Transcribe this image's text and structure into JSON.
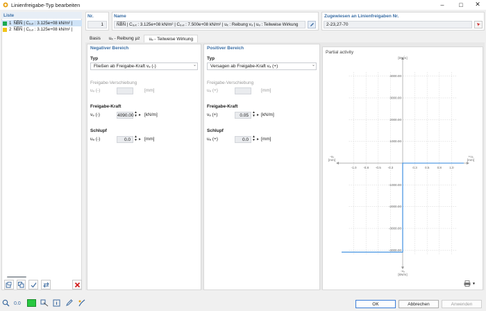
{
  "window": {
    "title": "Linienfreigabe-Typ bearbeiten",
    "min_icon": "minimize-icon",
    "max_icon": "maximize-icon",
    "close_icon": "close-icon"
  },
  "list": {
    "header": "Liste",
    "items": [
      {
        "num": "1",
        "text": "N̅B̅N̅ | Cᵤ,ₓ : 3.125e+08 kN/m² |",
        "color": "#1aa84f",
        "selected": true
      },
      {
        "num": "2",
        "text": "N̅B̅N̅ | Cᵤ,ₓ : 3.125e+08 kN/m² |",
        "color": "#f0c419",
        "selected": false
      }
    ],
    "toolbar_icons": [
      "new-icon",
      "copy-icon",
      "check-icon",
      "compare-icon"
    ],
    "delete_icon": "delete-icon"
  },
  "nr": {
    "header": "Nr.",
    "value": "1"
  },
  "name": {
    "header": "Name",
    "value": "N̅B̅N̅ | Cᵤ,ₓ : 3.125e+08 kN/m² | Cᵤ,ₔ : 7.500e+08 kN/m² | uₓ : Reibung vₔ | uₔ : Teilweise Wirkung"
  },
  "assigned": {
    "header": "Zugewiesen an Linienfreigaben Nr.",
    "value": "2-23,27-70"
  },
  "tabs": [
    {
      "label": "Basis",
      "active": false
    },
    {
      "label": "uₓ - Reibung μz",
      "active": false
    },
    {
      "label": "uₔ - Teilweise Wirkung",
      "active": true
    }
  ],
  "negative": {
    "header": "Negativer Bereich",
    "type_label": "Typ",
    "type_value": "Fließen ab Freigabe-Kraft vₔ (-)",
    "disp_label": "Freigabe-Verschiebung",
    "disp_sym": "uₔ (-)",
    "disp_unit": "[mm]",
    "force_label": "Freigabe-Kraft",
    "force_sym": "vₔ (-)",
    "force_value": "4090.00",
    "force_unit": "[kN/m]",
    "slip_label": "Schlupf",
    "slip_sym": "uₔ (-)",
    "slip_value": "0.0",
    "slip_unit": "[mm]"
  },
  "positive": {
    "header": "Positiver Bereich",
    "type_label": "Typ",
    "type_value": "Versagen ab Freigabe-Kraft vₔ (+)",
    "disp_label": "Freigabe-Verschiebung",
    "disp_sym": "uₔ (+)",
    "disp_unit": "[mm]",
    "force_label": "Freigabe-Kraft",
    "force_sym": "vₔ (+)",
    "force_value": "0.05",
    "force_unit": "[kN/m]",
    "slip_label": "Schlupf",
    "slip_sym": "uₔ (+)",
    "slip_value": "0.0",
    "slip_unit": "[mm]"
  },
  "chart_data": {
    "type": "line",
    "title": "Partial activity",
    "xlabel_left": "-uₔ [mm]",
    "xlabel_right": "+uₔ [mm]",
    "ylabel_top": "+vₔ [kN/m]",
    "ylabel_bottom": "-vₔ [kN/m]",
    "xlim": [
      -1.25,
      1.25
    ],
    "ylim": [
      -4500,
      4500
    ],
    "x_ticks": [
      "-1.0",
      "-0.8",
      "-0.5",
      "-0.3",
      "0.3",
      "0.5",
      "0.8",
      "1.0"
    ],
    "x_tick_values": [
      -1.0,
      -0.75,
      -0.5,
      -0.25,
      0.25,
      0.5,
      0.75,
      1.0
    ],
    "y_ticks": [
      "4000.00",
      "3000.00",
      "2000.00",
      "1000.00",
      "-1000.00",
      "-2000.00",
      "-3000.00",
      "-4000.00"
    ],
    "y_tick_values": [
      4000,
      3000,
      2000,
      1000,
      -1000,
      -2000,
      -3000,
      -4000
    ],
    "grid": true,
    "series": [
      {
        "x": [
          -1.25,
          0.0,
          0.0,
          1.25
        ],
        "y": [
          -4090,
          -4090,
          0.05,
          0.05
        ],
        "color": "#2e86de"
      }
    ]
  },
  "chart_toolbar": {
    "print_icon": "print-icon",
    "dropdown_icon": "chevron-down-icon"
  },
  "footer": {
    "icons": [
      "search-icon",
      "units-icon",
      "color-icon",
      "select-icon",
      "info-icon",
      "edit-icon",
      "script-icon"
    ],
    "ok": "OK",
    "cancel": "Abbrechen",
    "apply": "Anwenden"
  }
}
